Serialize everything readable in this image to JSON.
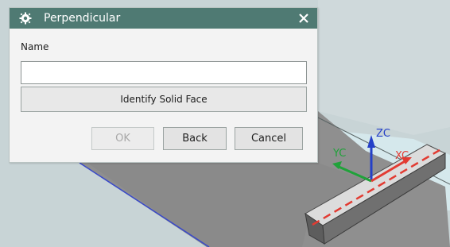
{
  "dialog": {
    "title": "Perpendicular",
    "name_label": "Name",
    "name_value": "",
    "identify_button": "Identify Solid Face",
    "ok_button": "OK",
    "back_button": "Back",
    "cancel_button": "Cancel"
  },
  "axes": {
    "zc": "ZC",
    "yc": "YC",
    "xc": "XC"
  },
  "colors": {
    "titlebar": "#4f7a73",
    "viewport_background": "#c9d6d8",
    "top_face": "#d6e9ec",
    "side_face": "#8c8c8c",
    "zc_axis": "#2440c8",
    "yc_axis": "#20a23a",
    "xc_axis": "#e23b32"
  }
}
